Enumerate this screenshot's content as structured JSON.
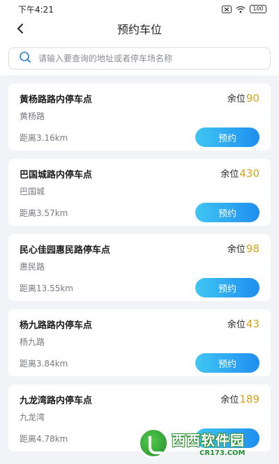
{
  "status_bar": {
    "time": "下午4:21",
    "battery": "100",
    "icons": [
      "sim-x-icon",
      "wifi-icon",
      "battery-icon"
    ]
  },
  "nav": {
    "back_icon": "chevron-left-icon",
    "title": "预约车位"
  },
  "search": {
    "placeholder": "请输入要查询的地址或者停车场名称",
    "value": ""
  },
  "remain_label": "余位",
  "reserve_label": "预约",
  "colors": {
    "accent_number": "#d6a21a",
    "button_gradient_start": "#3fc6f3",
    "button_gradient_end": "#1f8ef0"
  },
  "lots": [
    {
      "name": "黄杨路路内停车点",
      "road": "黄杨路",
      "distance": "距离3.16km",
      "remain": "90"
    },
    {
      "name": "巴国城路内停车点",
      "road": "巴国城",
      "distance": "距离3.57km",
      "remain": "430"
    },
    {
      "name": "民心佳园惠民路停车点",
      "road": "惠民路",
      "distance": "距离13.55km",
      "remain": "98"
    },
    {
      "name": "杨九路路内停车点",
      "road": "杨九路",
      "distance": "距离3.84km",
      "remain": "43"
    },
    {
      "name": "九龙湾路内停车点",
      "road": "九龙湾",
      "distance": "距离4.78km",
      "remain": "189"
    }
  ],
  "watermark": {
    "main": "西西软件园",
    "sub": "CR173.COM"
  }
}
